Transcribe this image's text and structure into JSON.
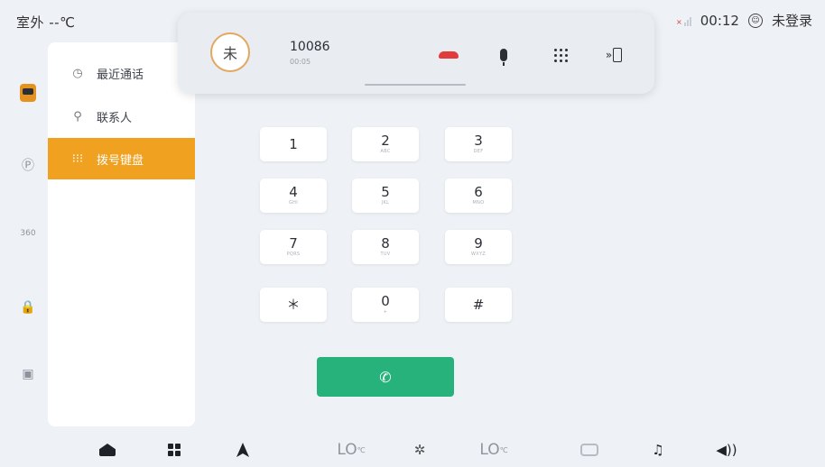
{
  "status_bar": {
    "outside_temp": "室外 --℃",
    "time": "00:12",
    "login_status": "未登录",
    "signal_icon": "signal-off-icon",
    "user_icon": "user-circle-icon"
  },
  "rail": {
    "items": [
      {
        "name": "phone",
        "icon": "phone-card-icon",
        "active": true
      },
      {
        "name": "parking",
        "icon": "parking-icon"
      },
      {
        "name": "view-360",
        "icon": "360-view-icon",
        "label": "360"
      },
      {
        "name": "car-lock",
        "icon": "car-lock-icon"
      },
      {
        "name": "card",
        "icon": "card-reader-icon"
      }
    ]
  },
  "side_menu": {
    "items": [
      {
        "label": "最近通话",
        "icon": "clock-icon"
      },
      {
        "label": "联系人",
        "icon": "person-icon"
      },
      {
        "label": "拨号键盘",
        "icon": "dialpad-icon",
        "active": true
      }
    ]
  },
  "call": {
    "avatar_char": "未",
    "number": "10086",
    "duration": "00:05"
  },
  "keypad": {
    "keys": [
      {
        "digit": "1",
        "letters": ""
      },
      {
        "digit": "2",
        "letters": "ABC"
      },
      {
        "digit": "3",
        "letters": "DEF"
      },
      {
        "digit": "4",
        "letters": "GHI"
      },
      {
        "digit": "5",
        "letters": "JKL"
      },
      {
        "digit": "6",
        "letters": "MNO"
      },
      {
        "digit": "7",
        "letters": "PQRS"
      },
      {
        "digit": "8",
        "letters": "TUV"
      },
      {
        "digit": "9",
        "letters": "WXYZ"
      },
      {
        "digit": "＊",
        "letters": ""
      },
      {
        "digit": "0",
        "letters": "+"
      },
      {
        "digit": "#",
        "letters": ""
      }
    ]
  },
  "dock": {
    "left_temp": "LO",
    "right_temp": "LO",
    "temp_unit": "℃"
  },
  "colors": {
    "accent": "#efa11f",
    "call_green": "#27b27c",
    "hangup_red": "#e13b3b"
  }
}
